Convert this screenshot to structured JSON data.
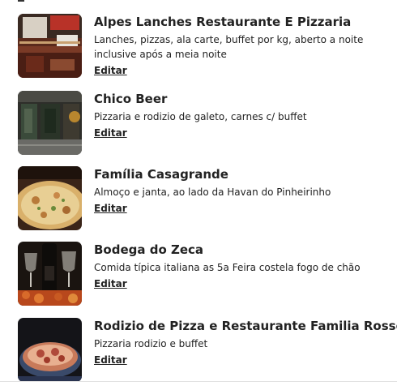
{
  "restaurants": [
    {
      "name": "Alpes Lanches Restaurante E Pizzaria",
      "description": "Lanches, pizzas, ala carte, buffet por kg, aberto a noite inclusive após a meia noite",
      "edit_label": "Editar"
    },
    {
      "name": "Chico Beer",
      "description": "Pizzaria e rodizio de galeto, carnes c/ buffet",
      "edit_label": "Editar"
    },
    {
      "name": "Família Casagrande",
      "description": "Almoço e janta, ao lado da Havan do Pinheirinho",
      "edit_label": "Editar"
    },
    {
      "name": "Bodega do Zeca",
      "description": "Comida típica italiana as 5a Feira costela fogo de chão",
      "edit_label": "Editar"
    },
    {
      "name": "Rodizio de Pizza e Restaurante Familia Rosso",
      "description": "Pizzaria rodizio e buffet",
      "edit_label": "Editar"
    }
  ]
}
